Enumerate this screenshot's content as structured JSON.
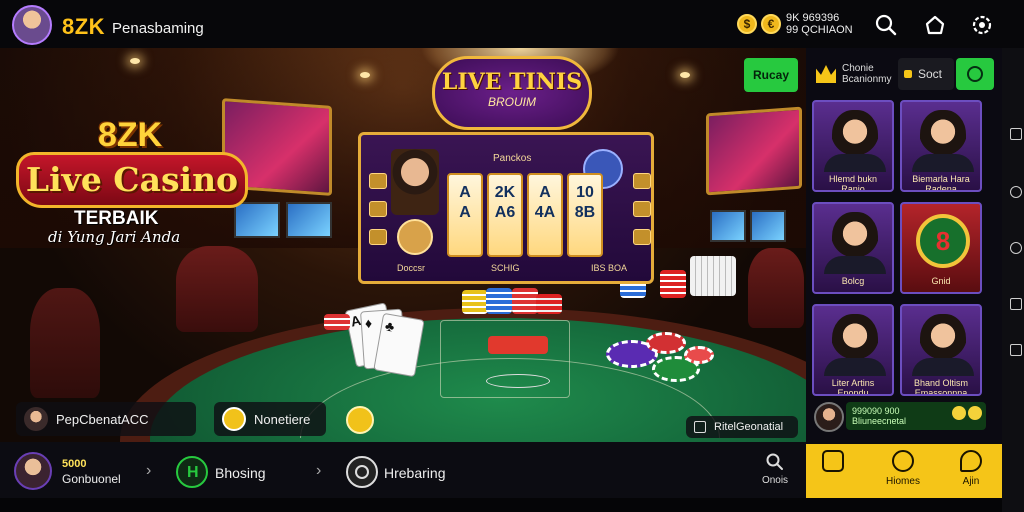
{
  "header": {
    "brand": "8ZK",
    "subtitle": "Penasbaming",
    "coin_icon_1": "currency-icon",
    "coin_icon_2": "currency-alt-icon",
    "balance_line1": "9K 969396",
    "balance_line2": "99 QCHIAON"
  },
  "promo": {
    "brand": "8ZK",
    "headline": "Live Casino",
    "line2": "TERBAIK",
    "tagline": "di Yung Jari Anda"
  },
  "game": {
    "sign_title": "LIVE TINIS",
    "sign_subtitle": "BROUIM",
    "panel_title": "Panckos",
    "cards": [
      {
        "top": "A",
        "bottom": "A"
      },
      {
        "top": "2K",
        "bottom": "A6"
      },
      {
        "top": "A",
        "bottom": "4A"
      },
      {
        "top": "10",
        "bottom": "8B"
      }
    ],
    "footer_left": "Doccsr",
    "footer_mid": "SCHIG",
    "footer_right": "IBS BOA"
  },
  "overlay": {
    "pill1_label": "PepCbenatACC",
    "pill2_label": "Nonetiere",
    "right_note": "RitelGeonatial"
  },
  "sidebar": {
    "button_label": "Rucay",
    "crown_label": "Chonie\nBcanionmy",
    "sort_label": "Soct",
    "tiles": [
      {
        "label": "Hlemd bukn\nRanio"
      },
      {
        "label": "Biemarla Hara\nRadena"
      },
      {
        "label": "Bolcg"
      },
      {
        "label": "Gnid"
      },
      {
        "label": "Liter Artins\nEnondu"
      },
      {
        "label": "Bhand Oltism\nEmassonnna"
      }
    ],
    "footer_line1": "999090 900",
    "footer_line2": "Bliuneecnetal"
  },
  "bottombar": {
    "amount": "5000",
    "account_label": "Gonbuonel",
    "nav2_label": "Bhosing",
    "nav3_label": "Hrebaring",
    "search_label": "Onois",
    "yellow_items": [
      "",
      "Hiomes",
      "Ajin"
    ]
  },
  "colors": {
    "brand_yellow": "#ffc21a",
    "accent_green": "#27c93f",
    "bottom_yellow": "#f5c518",
    "panel_gold": "#e5ac3a",
    "tile_purple": "#6c4ec0"
  }
}
